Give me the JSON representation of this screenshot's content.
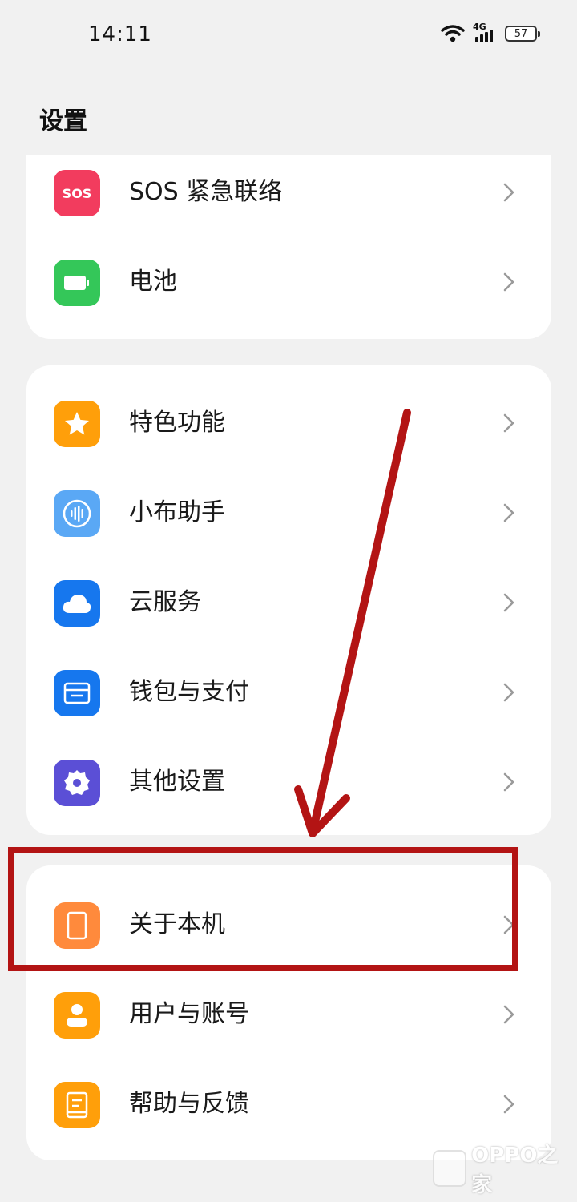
{
  "status_bar": {
    "time": "14:11",
    "network": "4G",
    "battery": "57"
  },
  "page": {
    "title": "设置"
  },
  "sections": [
    {
      "items": [
        {
          "label": "SOS 紧急联络",
          "icon": "sos-icon",
          "color": "#f23c5e",
          "icon_text": "SOS"
        },
        {
          "label": "电池",
          "icon": "battery-icon",
          "color": "#34c759"
        }
      ]
    },
    {
      "items": [
        {
          "label": "特色功能",
          "icon": "star-icon",
          "color": "#ff9f0a"
        },
        {
          "label": "小布助手",
          "icon": "voice-assistant-icon",
          "color": "#5aa8f5"
        },
        {
          "label": "云服务",
          "icon": "cloud-icon",
          "color": "#1677ee"
        },
        {
          "label": "钱包与支付",
          "icon": "wallet-icon",
          "color": "#1677ee"
        },
        {
          "label": "其他设置",
          "icon": "gear-icon",
          "color": "#5b4fd6"
        }
      ]
    },
    {
      "items": [
        {
          "label": "关于本机",
          "icon": "phone-icon",
          "color": "#ff8a3c"
        },
        {
          "label": "用户与账号",
          "icon": "user-icon",
          "color": "#ff9f0a"
        },
        {
          "label": "帮助与反馈",
          "icon": "help-book-icon",
          "color": "#ff9f0a"
        }
      ]
    }
  ],
  "annotation_color": "#b31414",
  "watermark": {
    "text": "OPPO之家"
  }
}
